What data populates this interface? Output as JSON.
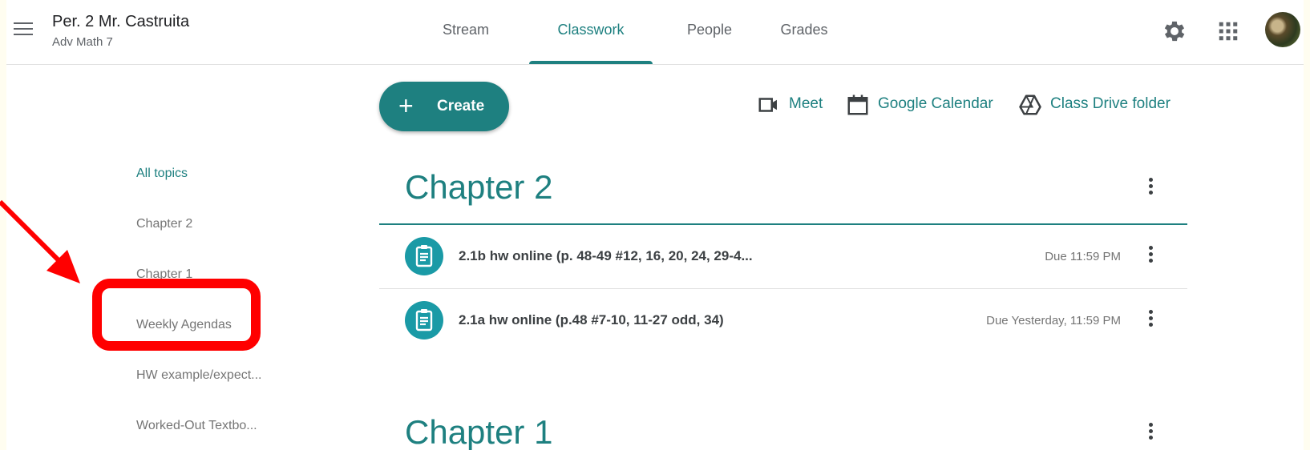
{
  "header": {
    "class_name": "Per. 2 Mr. Castruita",
    "class_subtitle": "Adv Math 7",
    "tabs": [
      {
        "label": "Stream",
        "active": false
      },
      {
        "label": "Classwork",
        "active": true
      },
      {
        "label": "People",
        "active": false
      },
      {
        "label": "Grades",
        "active": false
      }
    ]
  },
  "toolbar": {
    "create_label": "Create",
    "meet_label": "Meet",
    "calendar_label": "Google Calendar",
    "drive_label": "Class Drive folder"
  },
  "topics": [
    {
      "label": "All topics",
      "active": true
    },
    {
      "label": "Chapter 2"
    },
    {
      "label": "Chapter 1"
    },
    {
      "label": "Weekly Agendas"
    },
    {
      "label": "HW example/expect..."
    },
    {
      "label": "Worked-Out Textbo..."
    }
  ],
  "sections": [
    {
      "title": "Chapter 2",
      "items": [
        {
          "title": "2.1b hw online (p. 48-49 #12, 16, 20, 24, 29-4...",
          "due": "Due 11:59 PM"
        },
        {
          "title": "2.1a hw online (p.48 #7-10, 11-27 odd, 34)",
          "due": "Due Yesterday, 11:59 PM"
        }
      ]
    },
    {
      "title": "Chapter 1",
      "items": []
    }
  ],
  "colors": {
    "accent": "#1e8080",
    "annotation": "#ff0000",
    "background": "#fffdf0"
  },
  "icons": [
    "menu-icon",
    "gear-icon",
    "apps-grid-icon",
    "plus-icon",
    "video-camera-icon",
    "calendar-icon",
    "drive-icon",
    "assignment-icon",
    "more-vert-icon",
    "arrow-annotation"
  ]
}
